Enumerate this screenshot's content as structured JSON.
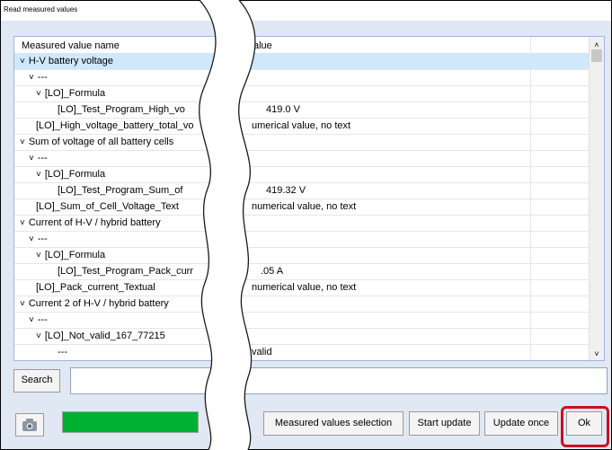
{
  "window": {
    "title": "Read measured values"
  },
  "table": {
    "columns": [
      "Measured value name",
      "alue"
    ],
    "rows": [
      {
        "name": "H-V battery voltage",
        "value": "",
        "indent": 0,
        "caret": "expanded",
        "selected": true
      },
      {
        "name": "---",
        "value": "",
        "indent": 1,
        "caret": "expanded",
        "selected": false
      },
      {
        "name": "[LO]_Formula",
        "value": "",
        "indent": 2,
        "caret": "expanded",
        "selected": false
      },
      {
        "name": "[LO]_Test_Program_High_vo",
        "value": "419.0 V",
        "indent": 3,
        "caret": "",
        "selected": false
      },
      {
        "name": "[LO]_High_voltage_battery_total_vo",
        "value": "umerical value, no text",
        "indent": 2,
        "caret": "",
        "selected": false
      },
      {
        "name": "Sum of voltage of all battery cells",
        "value": "",
        "indent": 0,
        "caret": "expanded",
        "selected": false
      },
      {
        "name": "---",
        "value": "",
        "indent": 1,
        "caret": "expanded",
        "selected": false
      },
      {
        "name": "[LO]_Formula",
        "value": "",
        "indent": 2,
        "caret": "expanded",
        "selected": false
      },
      {
        "name": "[LO]_Test_Program_Sum_of",
        "value": "419.32 V",
        "indent": 3,
        "caret": "",
        "selected": false
      },
      {
        "name": "[LO]_Sum_of_Cell_Voltage_Text",
        "value": "numerical value, no text",
        "indent": 2,
        "caret": "",
        "selected": false
      },
      {
        "name": "Current of H-V / hybrid battery",
        "value": "",
        "indent": 0,
        "caret": "expanded",
        "selected": false
      },
      {
        "name": "---",
        "value": "",
        "indent": 1,
        "caret": "expanded",
        "selected": false
      },
      {
        "name": "[LO]_Formula",
        "value": "",
        "indent": 2,
        "caret": "expanded",
        "selected": false
      },
      {
        "name": "[LO]_Test_Program_Pack_curr",
        "value": ".05 A",
        "indent": 3,
        "caret": "",
        "selected": false
      },
      {
        "name": "[LO]_Pack_current_Textual",
        "value": "numerical value, no text",
        "indent": 2,
        "caret": "",
        "selected": false
      },
      {
        "name": "Current 2 of H-V / hybrid battery",
        "value": "",
        "indent": 0,
        "caret": "expanded",
        "selected": false
      },
      {
        "name": "---",
        "value": "",
        "indent": 1,
        "caret": "expanded",
        "selected": false
      },
      {
        "name": "[LO]_Not_valid_167_77215",
        "value": "",
        "indent": 2,
        "caret": "expanded",
        "selected": false
      },
      {
        "name": "---",
        "value": "valid",
        "indent": 3,
        "caret": "",
        "selected": false
      }
    ]
  },
  "search": {
    "button_label": "Search",
    "value": ""
  },
  "progress": {
    "fraction": 1.0,
    "color": "#00b030"
  },
  "buttons": {
    "measured_values_selection": "Measured values selection",
    "start_update": "Start update",
    "update_once": "Update once",
    "ok": "Ok"
  },
  "icons": {
    "camera": "camera-icon",
    "expanded": "chevron-down-icon",
    "scroll_up": "arrow-up-icon",
    "scroll_down": "arrow-down-icon"
  },
  "colors": {
    "selected_row": "#cfe8fb",
    "highlight": "#cc1020"
  }
}
